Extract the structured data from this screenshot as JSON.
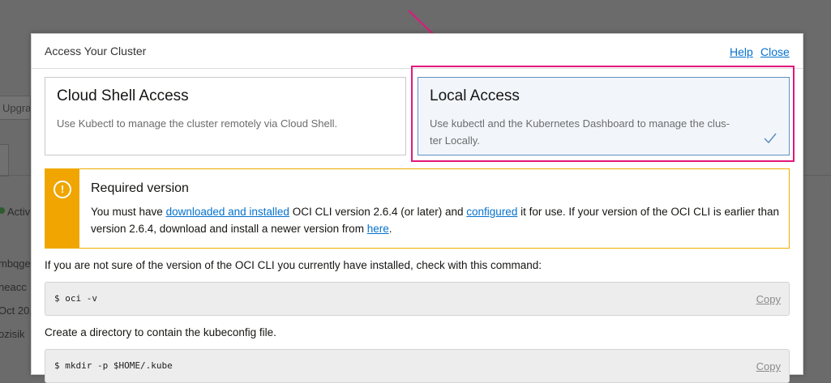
{
  "background": {
    "upgrade_btn": "Upgrad",
    "active_text": "Activ",
    "frag1": "mbqge",
    "frag2": "neacc",
    "frag3": "Oct 20,",
    "frag4": "ozisik"
  },
  "modal": {
    "title": "Access Your Cluster",
    "help_label": "Help",
    "close_label": "Close"
  },
  "options": {
    "cloud_shell": {
      "title": "Cloud Shell Access",
      "description": "Use Kubectl to manage the cluster remotely via Cloud Shell."
    },
    "local": {
      "title": "Local Access",
      "description_line1": "Use kubectl and the Kubernetes Dashboard to manage the clus-",
      "description_line2": "ter Locally.",
      "selected": true
    }
  },
  "warning": {
    "title": "Required version",
    "text_1": "You must have ",
    "link_1": "downloaded and installed",
    "text_2": " OCI CLI version 2.6.4 (or later) and ",
    "link_2": "configured",
    "text_3": " it for use. If your version of the OCI CLI is earlier than version 2.6.4, download and install a newer version from ",
    "link_3": "here",
    "text_4": "."
  },
  "steps": {
    "check_text": "If you are not sure of the version of the OCI CLI you currently have installed, check with this command:",
    "cmd_1": "$ oci -v",
    "create_dir_text": "Create a directory to contain the kubeconfig file.",
    "cmd_2": "$ mkdir -p $HOME/.kube",
    "copy_label": "Copy"
  },
  "colors": {
    "highlight": "#e3177b",
    "link": "#0572ce",
    "warning": "#f0a500"
  }
}
